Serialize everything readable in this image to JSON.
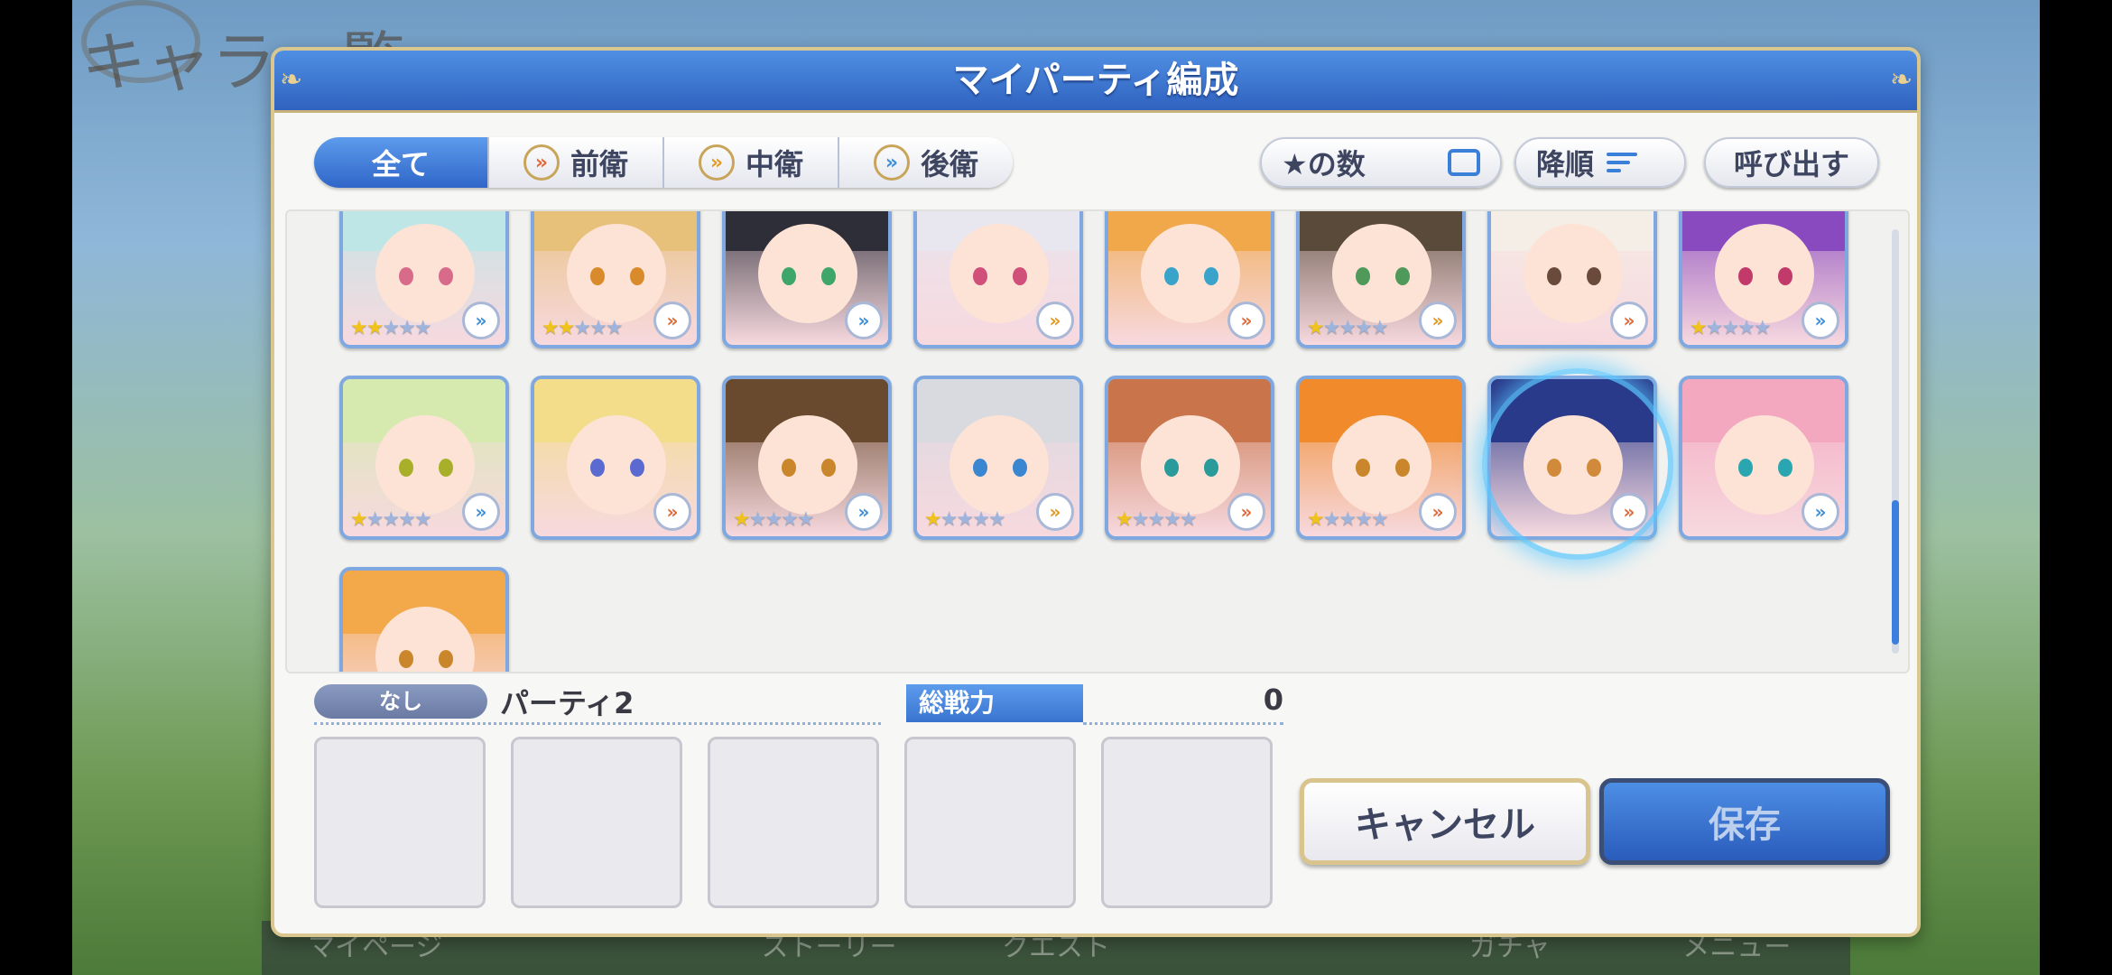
{
  "background": {
    "title": "キャラ一覧",
    "bottom_tabs": [
      "マイページ",
      "",
      "ストーリー",
      "クエスト",
      "",
      "ガチャ",
      "メニュー"
    ]
  },
  "dialog": {
    "title": "マイパーティ編成",
    "tabs": [
      {
        "label": "全て",
        "icon": "",
        "active": true
      },
      {
        "label": "前衛",
        "icon": "»",
        "active": false
      },
      {
        "label": "中衛",
        "icon": "»",
        "active": false
      },
      {
        "label": "後衛",
        "icon": "»",
        "active": false
      }
    ],
    "sort_key": "★の数",
    "sort_order": "降順",
    "load_button": "呼び出す"
  },
  "characters": [
    {
      "hair": "#bfe6e6",
      "eye": "#d86a8a",
      "stars": 2,
      "pos": "back"
    },
    {
      "hair": "#e7c07a",
      "eye": "#d98a2a",
      "stars": 2,
      "pos": "front"
    },
    {
      "hair": "#2e2e38",
      "eye": "#3fa66a",
      "stars": 0,
      "pos": "back"
    },
    {
      "hair": "#e8e6ee",
      "eye": "#d0507a",
      "stars": 0,
      "pos": "mid"
    },
    {
      "hair": "#f0a84a",
      "eye": "#3aa3c9",
      "stars": 0,
      "pos": "front"
    },
    {
      "hair": "#5a4a3a",
      "eye": "#4f9a5a",
      "stars": 1,
      "pos": "mid"
    },
    {
      "hair": "#f5eee6",
      "eye": "#6a4a3a",
      "stars": 0,
      "pos": "front"
    },
    {
      "hair": "#8a4abf",
      "eye": "#c23a6a",
      "stars": 1,
      "pos": "back"
    },
    {
      "hair": "#d6eab0",
      "eye": "#a8b02a",
      "stars": 1,
      "pos": "back"
    },
    {
      "hair": "#f3dd8a",
      "eye": "#5a6ad0",
      "stars": 0,
      "pos": "front"
    },
    {
      "hair": "#6a4a2e",
      "eye": "#c9862a",
      "stars": 1,
      "pos": "back"
    },
    {
      "hair": "#d9d9e0",
      "eye": "#3a86d0",
      "stars": 1,
      "pos": "mid"
    },
    {
      "hair": "#c9744a",
      "eye": "#2a9a9a",
      "stars": 1,
      "pos": "front"
    },
    {
      "hair": "#f08a2a",
      "eye": "#c9862a",
      "stars": 1,
      "pos": "front"
    },
    {
      "hair": "#2a3a8a",
      "eye": "#d08a3a",
      "stars": 0,
      "pos": "front"
    },
    {
      "hair": "#f3a8c0",
      "eye": "#2aa6b0",
      "stars": 0,
      "pos": "back"
    },
    {
      "hair": "#f3a84a",
      "eye": "#c9862a",
      "stars": 0,
      "pos": "front"
    }
  ],
  "party": {
    "badge": "なし",
    "name": "パーティ2",
    "power_label": "総戦力",
    "power_value": "0",
    "slots": 5
  },
  "buttons": {
    "cancel": "キャンセル",
    "save": "保存"
  },
  "colors": {
    "accent": "#2f66c8",
    "gold": "#d9c78f"
  }
}
